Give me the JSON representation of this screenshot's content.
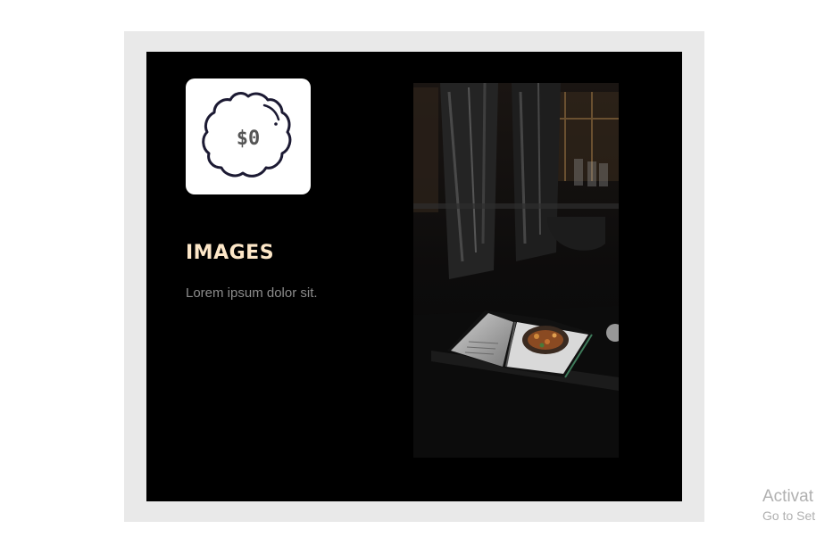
{
  "card": {
    "title": "IMAGES",
    "description": "Lorem ipsum dolor sit.",
    "badge_text": "$0",
    "badge_icon": "price-badge-icon",
    "photo": "dark-kitchen-photo-with-open-magazine"
  },
  "watermark": {
    "title": "Activat",
    "subtitle": "Go to Set"
  },
  "colors": {
    "page_background": "#ffffff",
    "frame_background": "#e9e9e9",
    "card_background": "#000000",
    "title_color": "#fde7c8",
    "description_color": "#8c8c8c",
    "icon_stroke": "#1c1a33"
  }
}
